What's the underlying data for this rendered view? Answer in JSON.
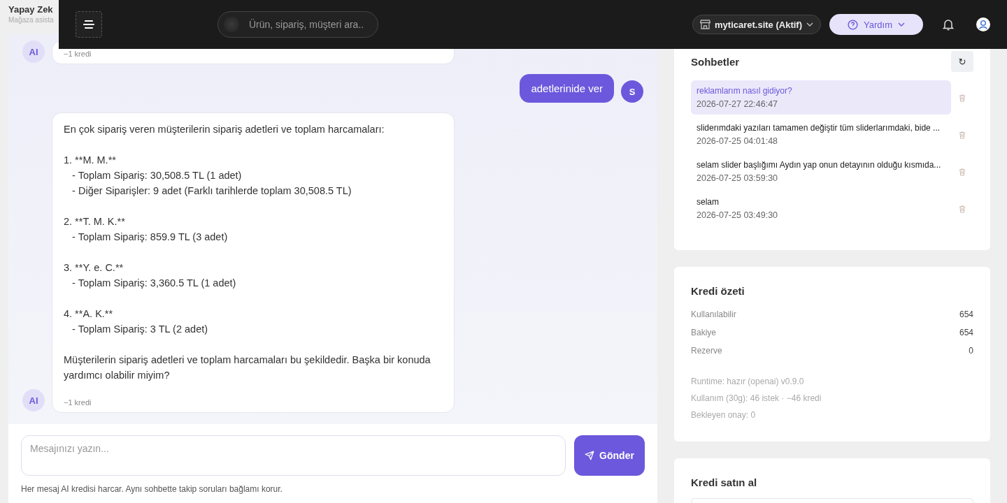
{
  "page": {
    "title": "Yapay Zek",
    "subtitle": "Mağaza asista"
  },
  "topbar": {
    "search": {
      "placeholder": "Ürün, sipariş, müşteri ara.."
    },
    "store": "myticaret.site (Aktif)",
    "help": "Yardım"
  },
  "messages": [
    {
      "kind": "ai",
      "avatar": "AI",
      "credit": "−1 kredi"
    },
    {
      "kind": "user",
      "avatar": "S",
      "paragraphs": [
        "adetlerinide ver"
      ]
    },
    {
      "kind": "ai",
      "avatar": "AI",
      "paragraphs": [
        "En çok sipariş veren müşterilerin sipariş adetleri ve toplam harcamaları:",
        "1. **M. M.**\n   - Toplam Sipariş: 30,508.5 TL (1 adet)\n   - Diğer Siparişler: 9 adet (Farklı tarihlerde toplam 30,508.5 TL)",
        "2. **T. M. K.**\n   - Toplam Sipariş: 859.9 TL (3 adet)",
        "3. **Y. e. C.**\n   - Toplam Sipariş: 3,360.5 TL (1 adet)",
        "4. **A. K.**\n   - Toplam Sipariş: 3 TL (2 adet)",
        "Müşterilerin sipariş adetleri ve toplam harcamaları bu şekildedir. Başka bir konuda yardımcı olabilir miyim?"
      ],
      "credit": "−1 kredi"
    }
  ],
  "composer": {
    "placeholder": "Mesajınızı yazın...",
    "send": "Gönder",
    "hint": "Her mesaj AI kredisi harcar. Aynı sohbette takip soruları bağlamı korur."
  },
  "chats": {
    "title": "Sohbetler",
    "refresh": "↻",
    "items": [
      {
        "title": "reklamlarım nasıl gidiyor?",
        "date": "2026-07-27 22:46:47",
        "selected": true
      },
      {
        "title": "sliderımdaki yazıları tamamen değiştir tüm sliderlarımdaki, bide ...",
        "date": "2026-07-25 04:01:48",
        "selected": false
      },
      {
        "title": "selam slider başlığımı Aydın yap onun detayının olduğu kısmıda...",
        "date": "2026-07-25 03:59:30",
        "selected": false
      },
      {
        "title": "selam",
        "date": "2026-07-25 03:49:30",
        "selected": false
      }
    ]
  },
  "credit_summary": {
    "title": "Kredi özeti",
    "rows": [
      {
        "label": "Kullanılabilir",
        "value": "654"
      },
      {
        "label": "Bakiye",
        "value": "654"
      },
      {
        "label": "Rezerve",
        "value": "0"
      }
    ],
    "notes": [
      "Runtime: hazır (openai) v0.9.0",
      "Kullanım (30g): 46 istek · −46 kredi",
      "Bekleyen onay: 0"
    ]
  },
  "buy_credit": {
    "title": "Kredi satın al"
  }
}
